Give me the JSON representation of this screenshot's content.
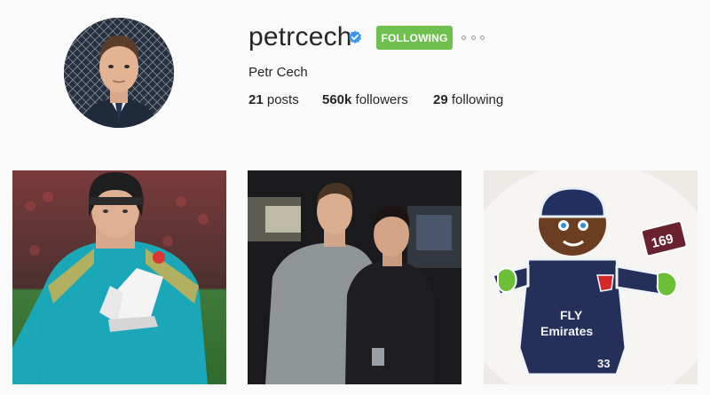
{
  "profile": {
    "username": "petrcech",
    "full_name": "Petr Cech",
    "verified_icon": "verified-badge-icon",
    "follow_button_label": "FOLLOWING",
    "more_options_icon": "ellipsis-icon"
  },
  "stats": {
    "posts_count": "21",
    "posts_label": "posts",
    "followers_count": "560k",
    "followers_label": "followers",
    "following_count": "29",
    "following_label": "following"
  },
  "colors": {
    "follow_button": "#70c050",
    "verified_badge": "#3897f0",
    "background": "#fafafa"
  },
  "posts": [
    {
      "subject": "goalkeeper in teal kit with headguard and gloves"
    },
    {
      "subject": "two men posing in a dark venue"
    },
    {
      "subject": "gingerbread figure",
      "icing_text_1": "FLY",
      "icing_text_2": "Emirates",
      "icing_number": "33",
      "sign_number": "169"
    }
  ]
}
